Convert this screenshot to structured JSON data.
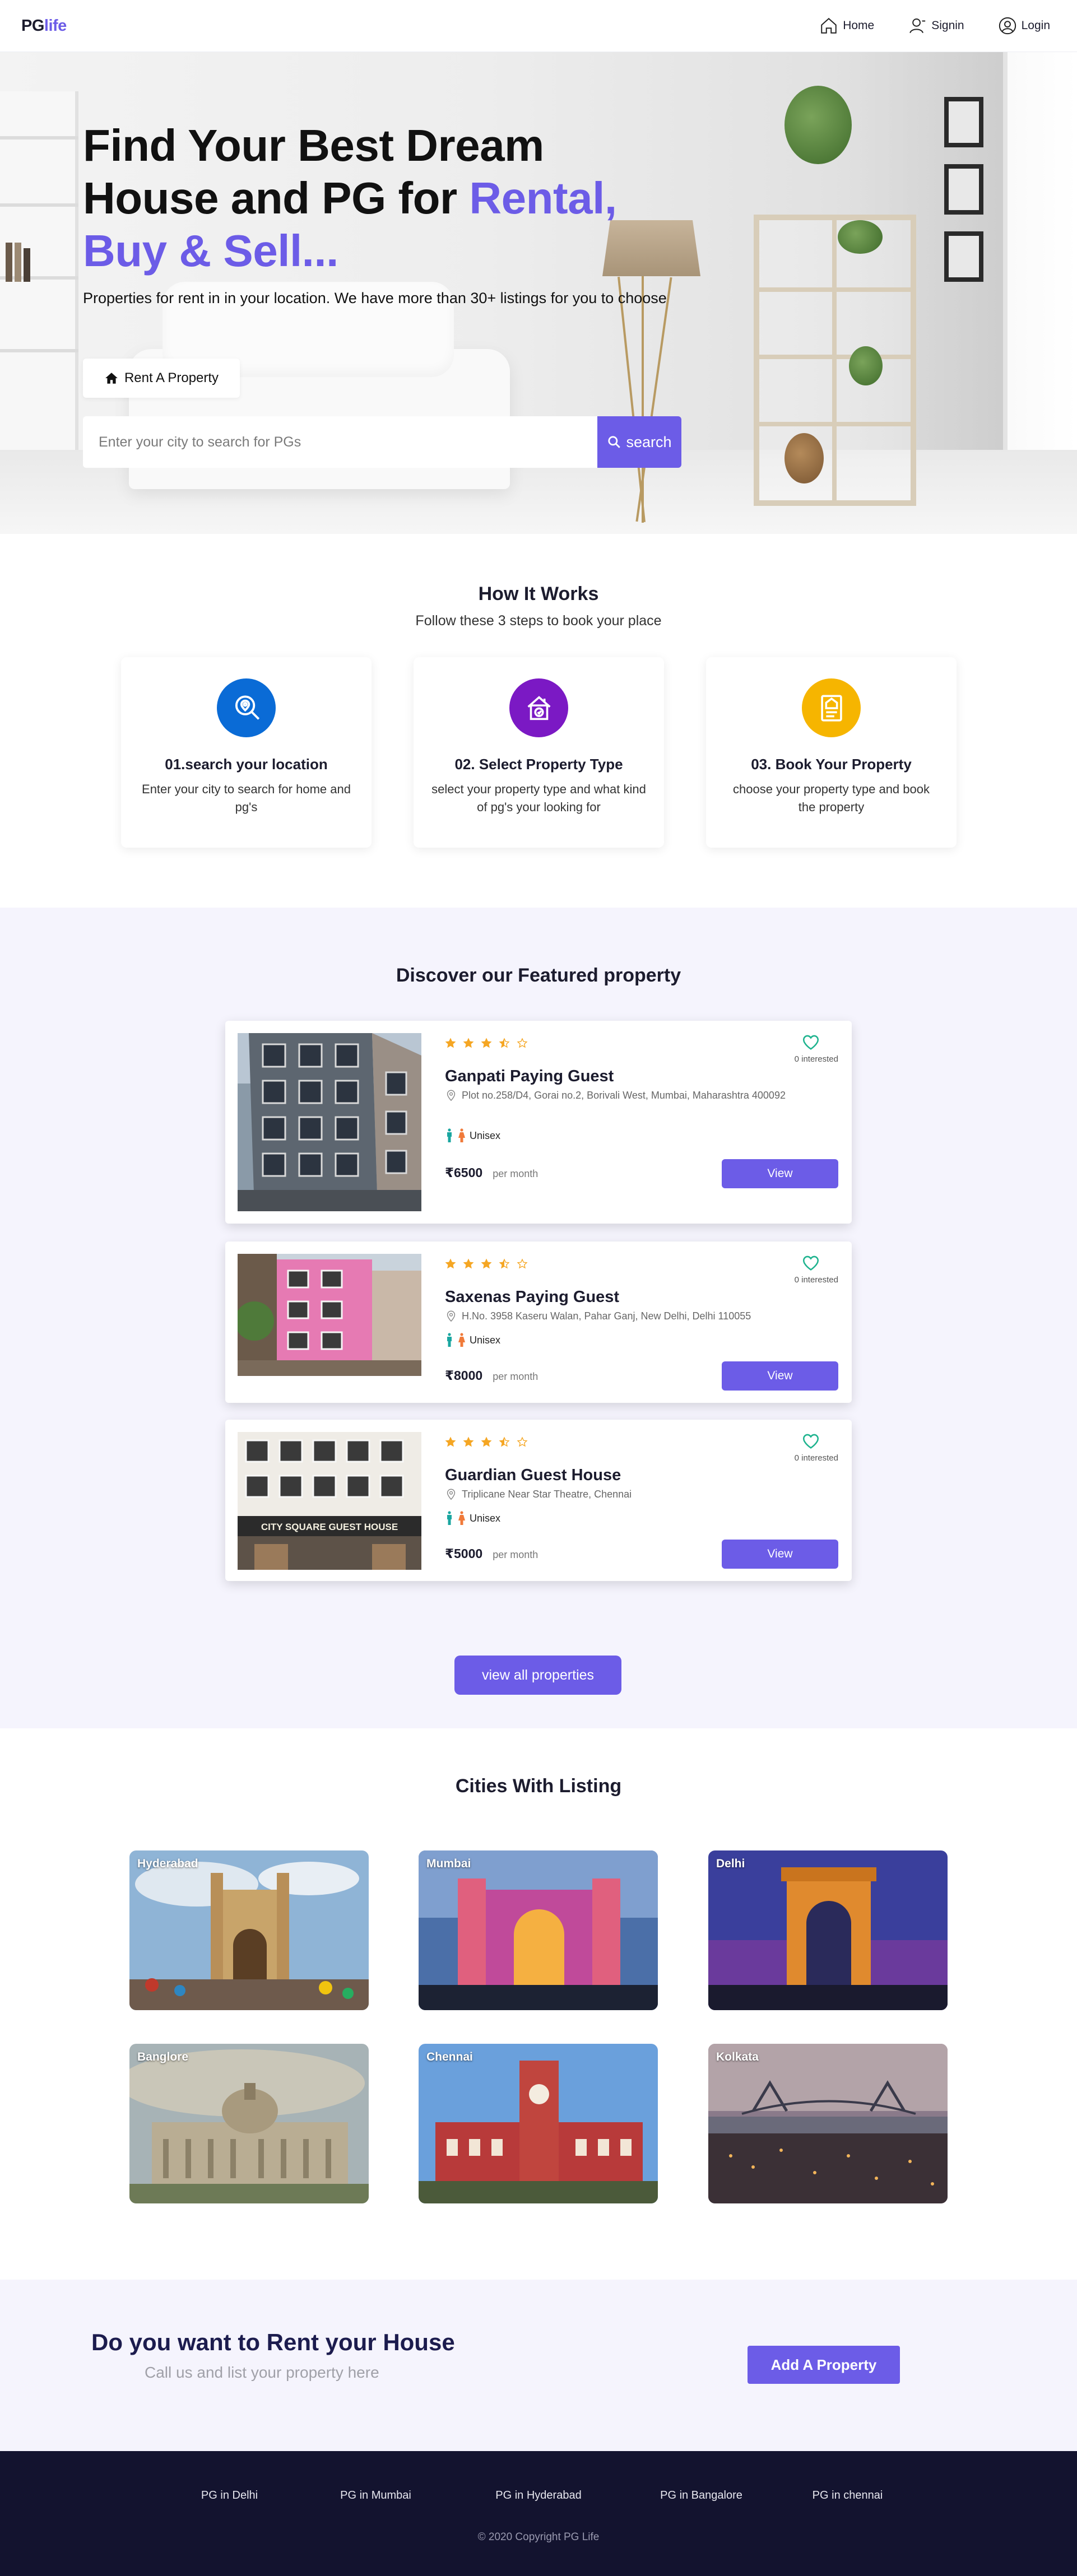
{
  "header": {
    "logo_part1": "PG",
    "logo_part2": "life",
    "nav": [
      {
        "label": "Home",
        "icon": "home-icon"
      },
      {
        "label": "Signin",
        "icon": "user-icon"
      },
      {
        "label": "Login",
        "icon": "user-circle-icon"
      }
    ]
  },
  "hero": {
    "title_line1": "Find Your Best Dream",
    "title_line2_plain": "House and PG for ",
    "title_line2_accent": "Rental,",
    "title_line3_accent": "Buy & Sell...",
    "subtitle": "Properties for rent in in your location. We have more than 30+ listings for you to choose",
    "rent_button": "Rent A Property",
    "search_placeholder": "Enter your city to search for PGs",
    "search_button": "search"
  },
  "how_it_works": {
    "title": "How It Works",
    "subtitle": "Follow these 3 steps to book your place",
    "steps": [
      {
        "title": "01.search your location",
        "desc": "Enter your city to search for home and pg's",
        "icon": "location-search-icon",
        "color": "#0a6bd6"
      },
      {
        "title": "02. Select Property Type",
        "desc": "select your property type and what kind of pg's your looking for",
        "icon": "house-select-icon",
        "color": "#7b19c4"
      },
      {
        "title": "03. Book Your Property",
        "desc": "choose your property type and book the property",
        "icon": "document-book-icon",
        "color": "#f6b500"
      }
    ]
  },
  "featured": {
    "title": "Discover our Featured property",
    "properties": [
      {
        "name": "Ganpati Paying Guest",
        "address": "Plot no.258/D4, Gorai no.2, Borivali West, Mumbai, Maharashtra 400092",
        "gender": "Unisex",
        "price": "6500",
        "per": "per month",
        "interested": "0 interested",
        "rating": 3.5,
        "view": "View"
      },
      {
        "name": "Saxenas Paying Guest",
        "address": "H.No. 3958 Kaseru Walan, Pahar Ganj, New Delhi, Delhi 110055",
        "gender": "Unisex",
        "price": "8000",
        "per": "per month",
        "interested": "0 interested",
        "rating": 3.5,
        "view": "View"
      },
      {
        "name": "Guardian Guest House",
        "address": "Triplicane Near Star Theatre, Chennai",
        "gender": "Unisex",
        "price": "5000",
        "per": "per month",
        "interested": "0 interested",
        "rating": 3.5,
        "view": "View",
        "sign_text": "CITY SQUARE GUEST HOUSE"
      }
    ],
    "currency": "₹",
    "view_all": "view all properties"
  },
  "cities": {
    "title": "Cities With Listing",
    "items": [
      "Hyderabad",
      "Mumbai",
      "Delhi",
      "Banglore",
      "Chennai",
      "Kolkata"
    ]
  },
  "cta": {
    "title": "Do you want to Rent your House",
    "subtitle": "Call us and list your property here",
    "button": "Add A Property"
  },
  "footer": {
    "links": [
      "PG in Delhi",
      "PG in Mumbai",
      "PG in Hyderabad",
      "PG in Bangalore",
      "PG in chennai"
    ],
    "copyright": "© 2020 Copyright PG Life"
  },
  "colors": {
    "accent": "#6c5ce7",
    "footer_bg": "#13132f",
    "section_tint": "#f5f4fd",
    "star": "#f5a623",
    "heart": "#1db38e"
  }
}
